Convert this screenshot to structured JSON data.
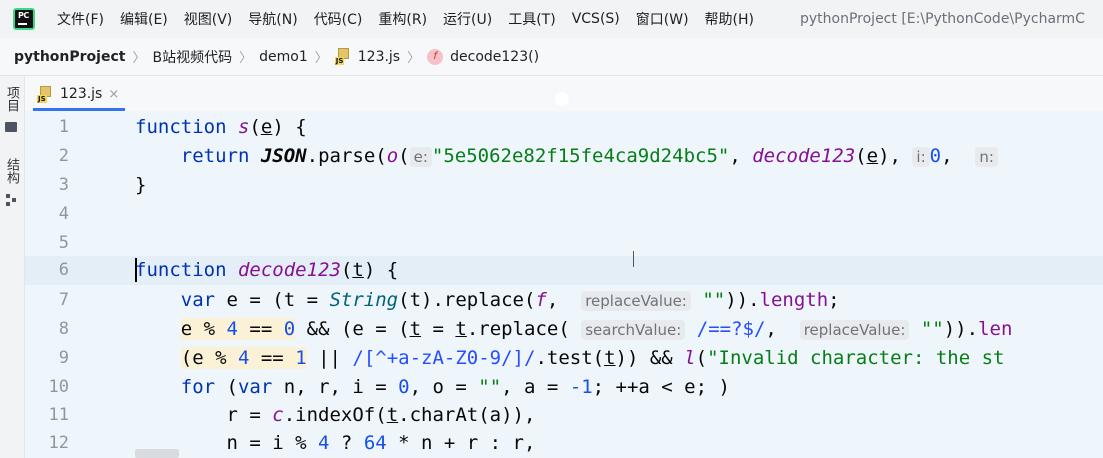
{
  "menubar": {
    "items": [
      "文件(F)",
      "编辑(E)",
      "视图(V)",
      "导航(N)",
      "代码(C)",
      "重构(R)",
      "运行(U)",
      "工具(T)",
      "VCS(S)",
      "窗口(W)",
      "帮助(H)"
    ],
    "window_title": "pythonProject [E:\\PythonCode\\PycharmC",
    "logo_text": "PC"
  },
  "breadcrumb": {
    "project": "pythonProject",
    "folder": "B站视频代码",
    "subfolder": "demo1",
    "file": "123.js",
    "function": "decode123()",
    "function_icon_letter": "f"
  },
  "toolstrip": {
    "project_label": "项目",
    "structure_label": "结构"
  },
  "tabs": [
    {
      "label": "123.js",
      "close": "×"
    }
  ],
  "editor": {
    "line_numbers": [
      "1",
      "2",
      "3",
      "4",
      "5",
      "6",
      "7",
      "8",
      "9",
      "10",
      "11",
      "12"
    ],
    "current_line": 6
  },
  "colors": {
    "keyword": "#0033b3",
    "function_name": "#871094",
    "string": "#067d17",
    "number": "#1750eb",
    "editor_bg": "#eef6fb",
    "accent": "#3574f0"
  }
}
